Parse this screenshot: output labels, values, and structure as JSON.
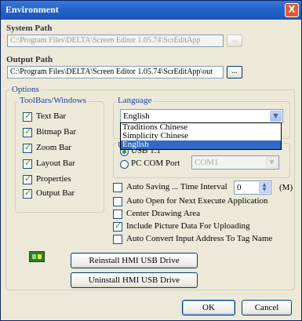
{
  "window": {
    "title": "Environment",
    "close_glyph": "X"
  },
  "system_path": {
    "label": "System Path",
    "value": "C:\\Program Files\\DELTA\\Screen Editor 1.05.74\\ScrEditApp",
    "browse_label": "..."
  },
  "output_path": {
    "label": "Output Path",
    "value": "C:\\Program Files\\DELTA\\Screen Editor 1.05.74\\ScrEditApp\\out",
    "browse_label": "..."
  },
  "options": {
    "label": "Options",
    "toolbars_label": "ToolBars/Windows",
    "toolbars": [
      {
        "label": "Text Bar",
        "checked": true
      },
      {
        "label": "Bitmap Bar",
        "checked": true
      },
      {
        "label": "Zoom Bar",
        "checked": true
      },
      {
        "label": "Layout Bar",
        "checked": true
      },
      {
        "label": "Properties",
        "checked": true
      },
      {
        "label": "Output Bar",
        "checked": true
      }
    ]
  },
  "language": {
    "label": "Language",
    "selected": "English",
    "options": [
      "Traditions Chinese",
      "Simplicity Chinese",
      "English"
    ]
  },
  "communication": {
    "partial_label": "U",
    "usb_label": "USB 1.1",
    "pc_com_label": "PC COM Port",
    "com_value": "COM1"
  },
  "settings": {
    "auto_saving_label": "Auto Saving ... Time Interval",
    "time_interval_value": "0",
    "time_unit": "(M)",
    "checks": [
      {
        "label": "Auto Open for Next Execute Application",
        "checked": false
      },
      {
        "label": "Center Drawing Area",
        "checked": false
      },
      {
        "label": "Include Picture Data For Uploading",
        "checked": true
      },
      {
        "label": "Auto Convert Input Address To Tag Name",
        "checked": false
      }
    ]
  },
  "buttons": {
    "reinstall": "Reinstall HMI USB Drive",
    "uninstall": "Uninstall HMI USB Drive",
    "ok": "OK",
    "cancel": "Cancel"
  }
}
